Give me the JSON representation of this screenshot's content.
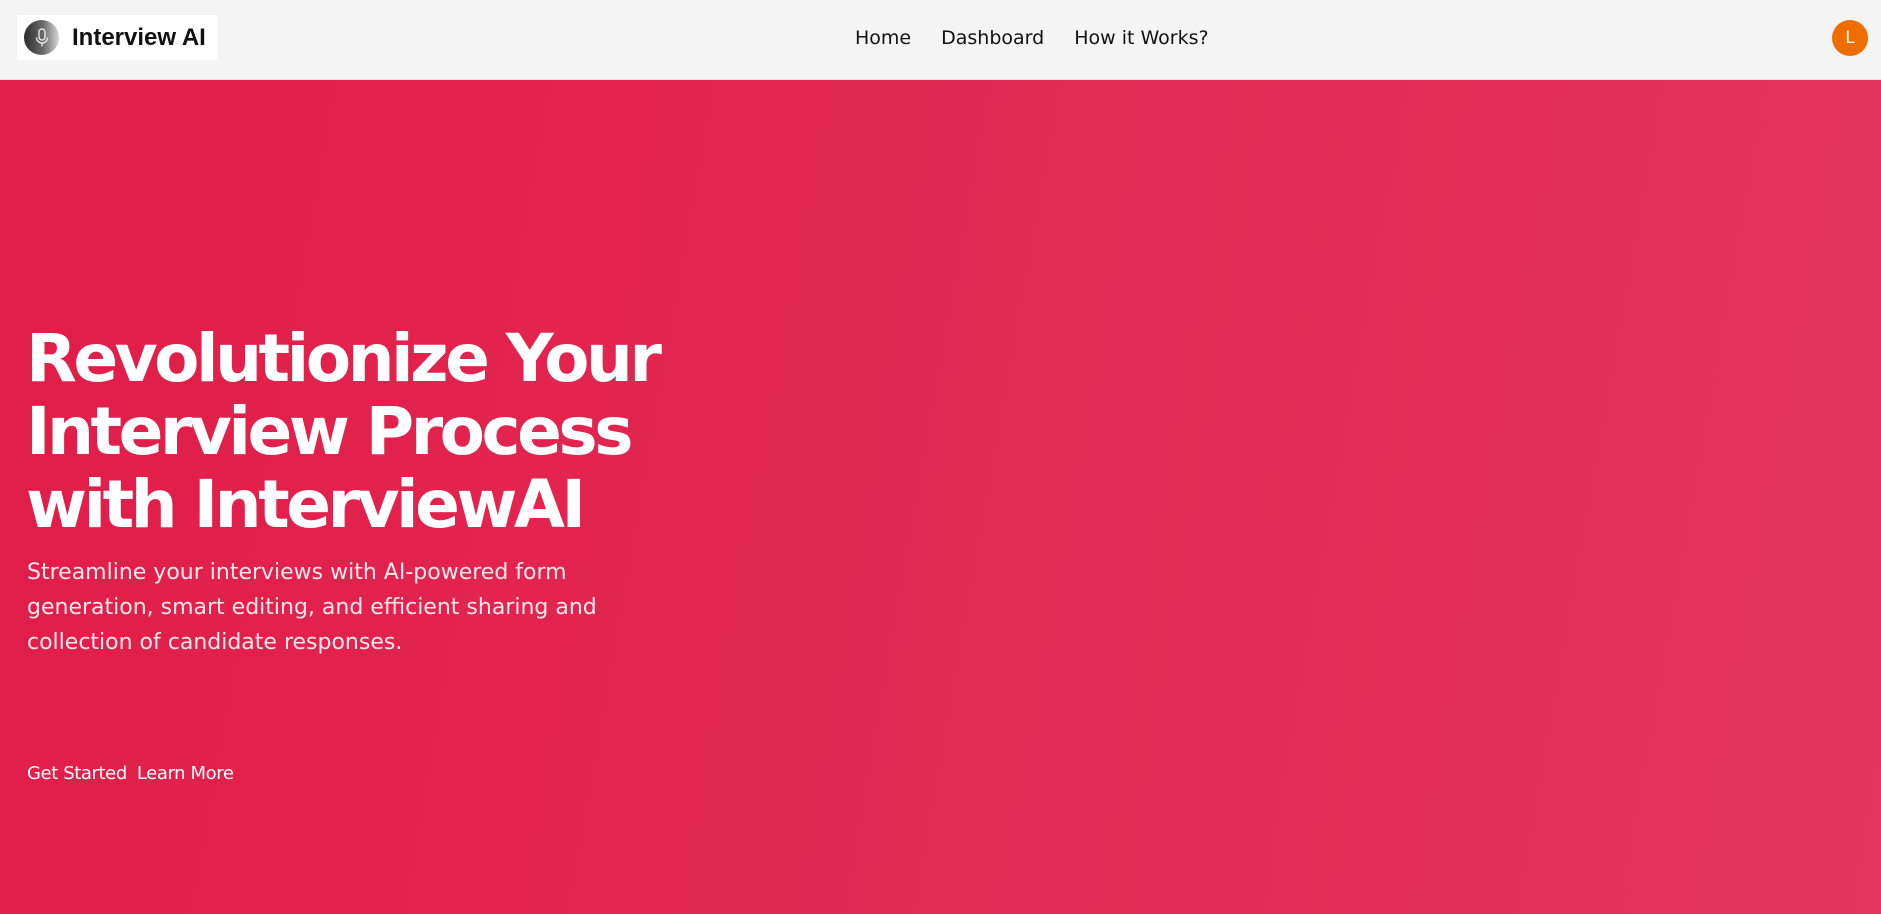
{
  "header": {
    "brand": {
      "name": "Interview AI",
      "logo_icon": "microphone-icon"
    },
    "nav": [
      {
        "label": "Home"
      },
      {
        "label": "Dashboard"
      },
      {
        "label": "How it Works?"
      }
    ],
    "avatar": {
      "initial": "L",
      "color": "#ef6c00"
    },
    "background": "#f4f4f4"
  },
  "hero": {
    "title_lines": [
      "Revolutionize Your",
      "Interview Process",
      "with InterviewAI"
    ],
    "subtitle_lines": [
      "Streamline your interviews with AI-powered form",
      "generation, smart editing, and efficient sharing and",
      "collection of candidate responses."
    ],
    "actions": {
      "primary_label": "Get Started",
      "secondary_label": "Learn More"
    },
    "gradient": [
      "#e11d48",
      "#e4355c"
    ]
  }
}
